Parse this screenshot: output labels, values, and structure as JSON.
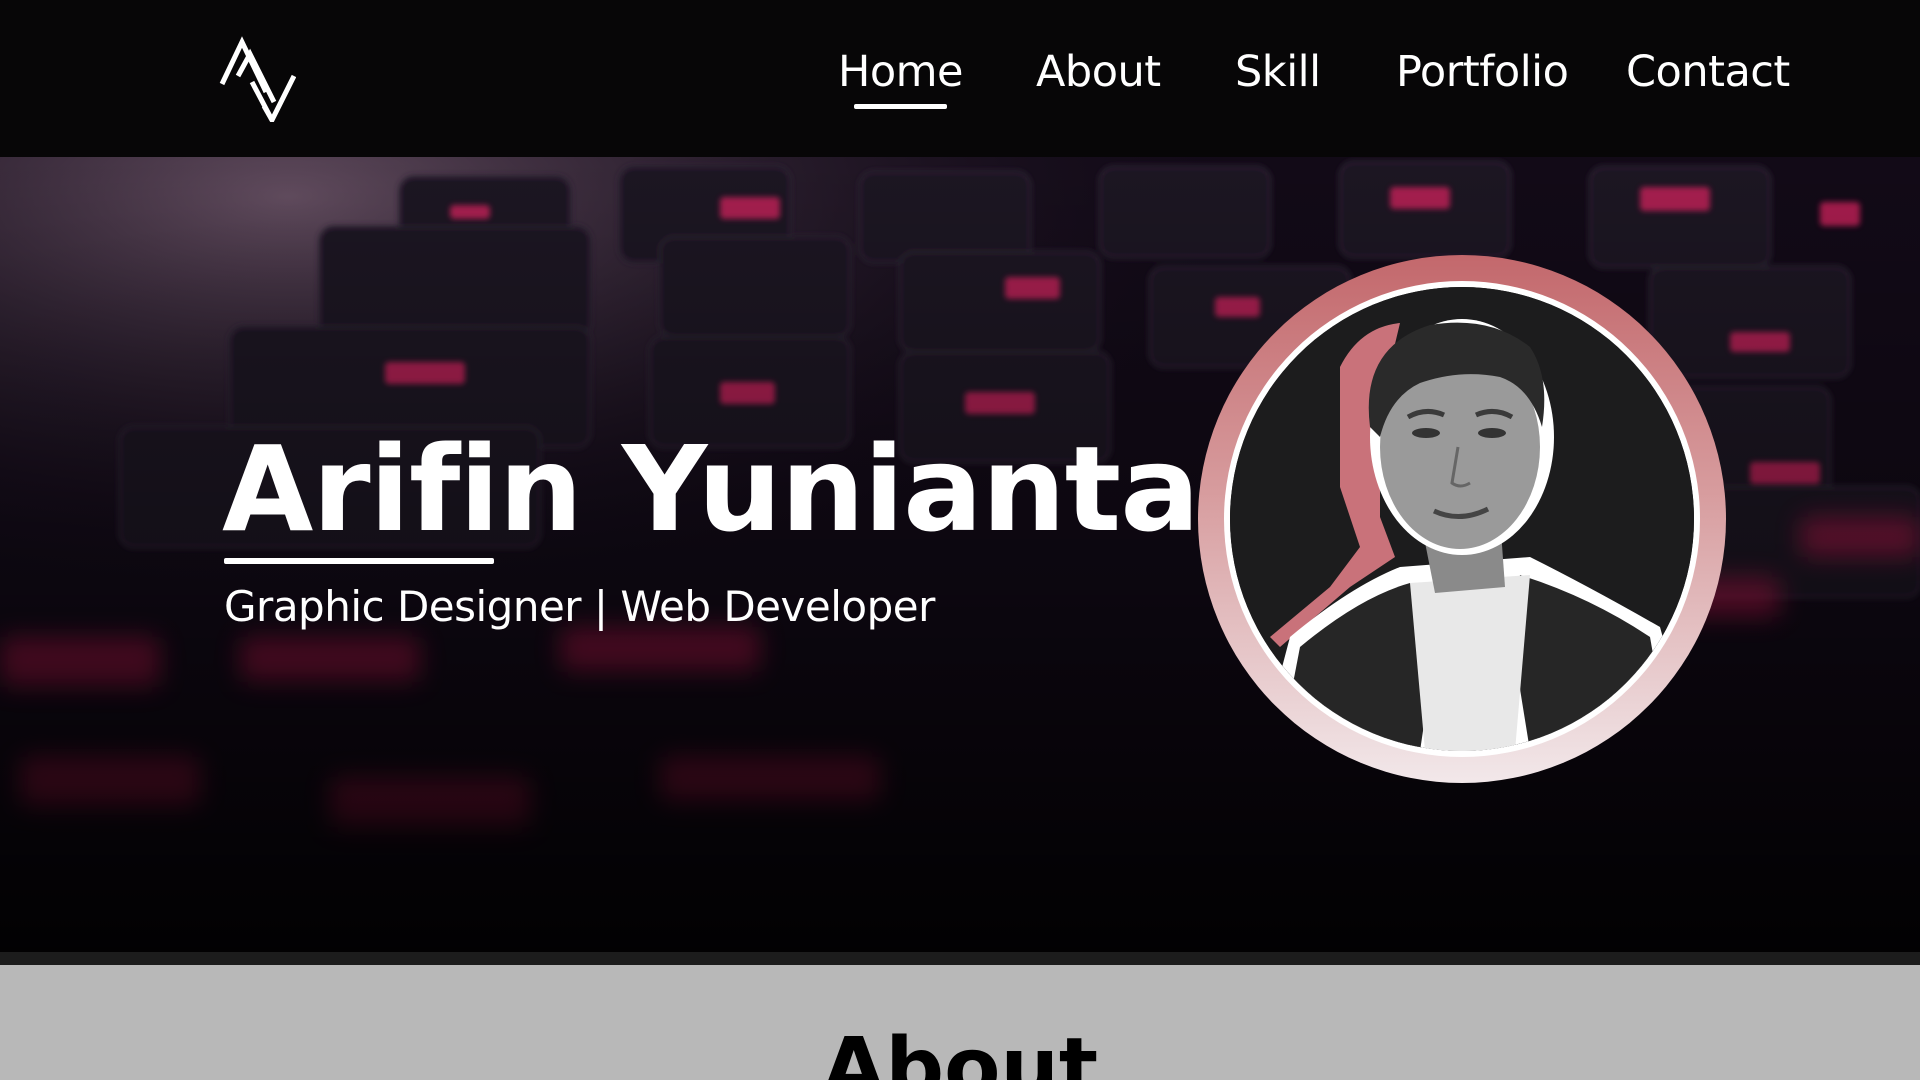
{
  "nav": {
    "items": [
      {
        "label": "Home",
        "active": true
      },
      {
        "label": "About",
        "active": false
      },
      {
        "label": "Skill",
        "active": false
      },
      {
        "label": "Portfolio",
        "active": false
      },
      {
        "label": "Contact",
        "active": false
      }
    ]
  },
  "brand": {
    "logo_icon": "monogram-logo-icon"
  },
  "hero": {
    "name": "Arifin Yunianta",
    "subtitle": "Graphic Designer | Web Developer",
    "background": "keyboard-photo-background",
    "profile_icon": "profile-photo"
  },
  "about": {
    "heading": "About"
  },
  "colors": {
    "navbar_bg": "#070607",
    "accent": "#e0306e",
    "ring_top": "#c3686c",
    "ring_bottom": "#f2e8ea",
    "about_bg": "#b8b8b8"
  }
}
